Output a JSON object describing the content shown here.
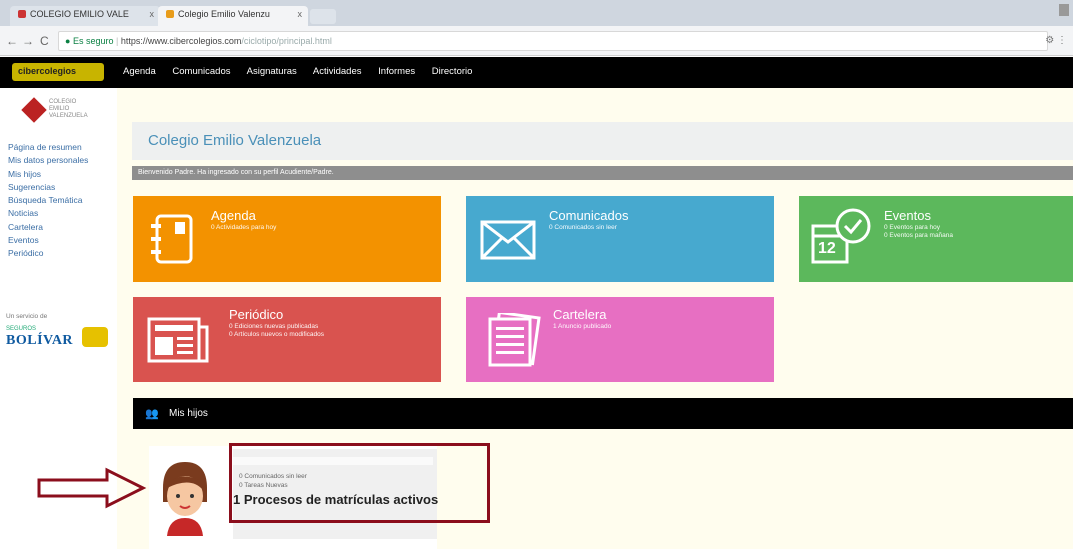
{
  "browser": {
    "tabs": [
      {
        "label": "COLEGIO EMILIO VALE",
        "close": "x"
      },
      {
        "label": "Colegio Emilio Valenzu",
        "close": "x"
      }
    ],
    "nav": {
      "back": "←",
      "forward": "→",
      "reload": "C"
    },
    "url": {
      "secure_label": "Es seguro",
      "prefix": "https://www.cibercolegios.com",
      "rest": "/ciclotipo/principal.html"
    }
  },
  "site": {
    "logo_text": "cibercolegios",
    "menu": [
      "Agenda",
      "Comunicados",
      "Asignaturas",
      "Actividades",
      "Informes",
      "Directorio"
    ]
  },
  "sidebar": {
    "logo_text": "COLEGIO EMILIO VALENZUELA",
    "links": [
      "Página de resumen",
      "Mis datos personales",
      "Mis hijos",
      "Sugerencias",
      "Búsqueda Temática",
      "Noticias",
      "Cartelera",
      "Eventos",
      "Periódico"
    ],
    "sponsor_label": "Un servicio de",
    "sponsor_small": "SEGUROS",
    "sponsor_name": "BOLÍVAR"
  },
  "main": {
    "school_title": "Colegio Emilio Valenzuela",
    "welcome": "Bienvenido Padre. Ha ingresado con su perfil Acudiente/Padre.",
    "tiles": {
      "agenda": {
        "title": "Agenda",
        "lines": [
          "0 Actividades para hoy"
        ]
      },
      "comunicados": {
        "title": "Comunicados",
        "lines": [
          "0 Comunicados sin leer"
        ]
      },
      "eventos": {
        "title": "Eventos",
        "lines": [
          "0 Eventos para hoy",
          "0 Eventos para mañana"
        ],
        "calendar_day": "12"
      },
      "periodico": {
        "title": "Periódico",
        "lines": [
          "0 Ediciones nuevas publicadas",
          "0 Artículos nuevos o modificados"
        ]
      },
      "cartelera": {
        "title": "Cartelera",
        "lines": [
          "1 Anuncio publicado"
        ]
      }
    },
    "mis_hijos": {
      "label": "Mis hijos",
      "child": {
        "line1": "0 Comunicados sin leer",
        "line2": "0 Tareas Nuevas",
        "line3": "1 Procesos de matrículas activos"
      }
    }
  },
  "colors": {
    "agenda": "#f39200",
    "comunicados": "#47a9cf",
    "eventos": "#5cb85c",
    "periodico": "#d9534f",
    "cartelera": "#e76fc2",
    "highlight": "#8b0e1c"
  }
}
